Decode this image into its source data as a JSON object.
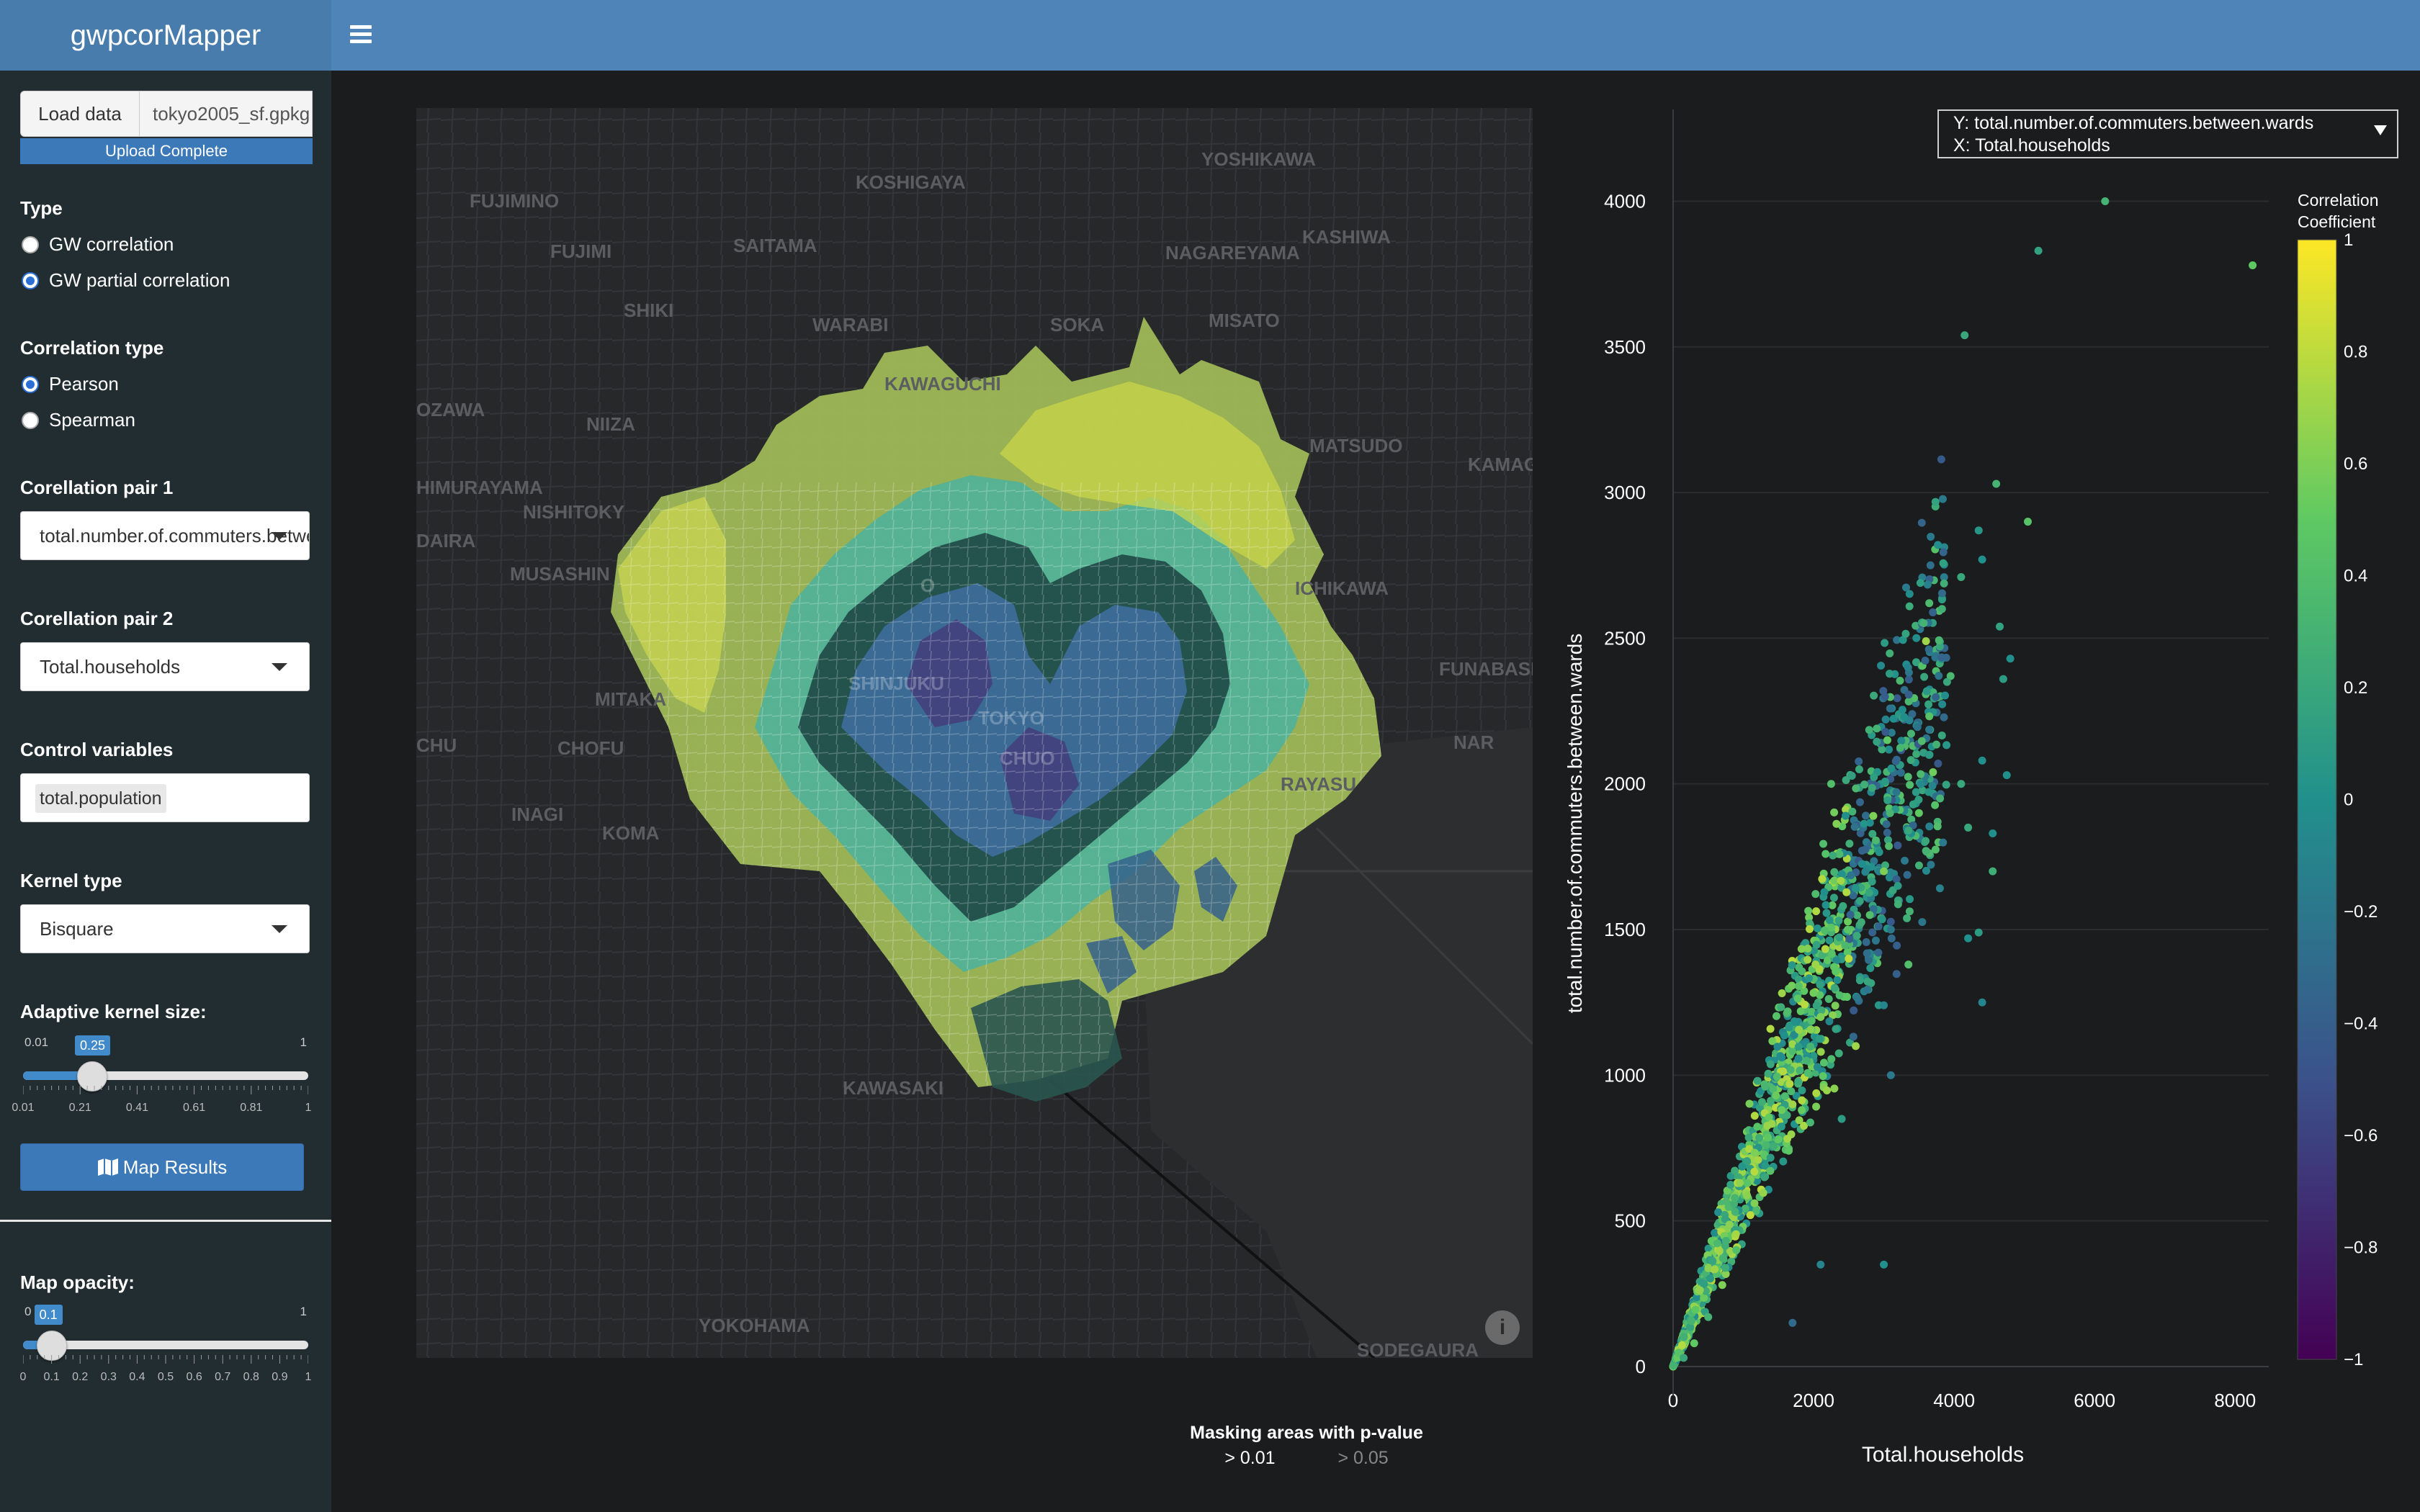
{
  "app": {
    "title": "gwpcorMapper"
  },
  "upload": {
    "button_label": "Load data",
    "file_name": "tokyo2005_sf.gpkg",
    "status": "Upload Complete"
  },
  "type": {
    "label": "Type",
    "options": [
      "GW correlation",
      "GW partial correlation"
    ],
    "selected": "GW partial correlation"
  },
  "correlation_type": {
    "label": "Correlation type",
    "options": [
      "Pearson",
      "Spearman"
    ],
    "selected": "Pearson"
  },
  "pair1": {
    "label": "Corellation pair 1",
    "value": "total.number.of.commuters.between.wards"
  },
  "pair2": {
    "label": "Corellation pair 2",
    "value": "Total.households"
  },
  "control": {
    "label": "Control variables",
    "value": "total.population"
  },
  "kernel": {
    "label": "Kernel type",
    "value": "Bisquare"
  },
  "kernel_size": {
    "label": "Adaptive kernel size:",
    "min": "0.01",
    "max": "1",
    "value": "0.25",
    "value_num": 0.25,
    "tick_labels": [
      "0.01",
      "0.21",
      "0.41",
      "0.61",
      "0.81",
      "1"
    ]
  },
  "map_button": {
    "label": "Map Results",
    "icon": "map-icon"
  },
  "opacity": {
    "label": "Map opacity:",
    "min": "0",
    "max": "1",
    "value": "0.1",
    "value_num": 0.1,
    "tick_labels": [
      "0",
      "0.1",
      "0.2",
      "0.3",
      "0.4",
      "0.5",
      "0.6",
      "0.7",
      "0.8",
      "0.9",
      "1"
    ]
  },
  "map": {
    "place_labels": [
      "KOSHIGAYA",
      "YOSHIKAWA",
      "FUJIMINO",
      "SAITAMA",
      "KASHIWA",
      "FUJIMI",
      "NAGAREYAMA",
      "SHIKI",
      "WARABI",
      "SOKA",
      "MISATO",
      "KAWAGUCHI",
      "OZAWA",
      "NIIZA",
      "MATSUDO",
      "KAMAGA",
      "HIMURAYAMA",
      "NISHITOKY",
      "DAIRA",
      "ICHIKAWA",
      "MUSASHIN",
      "FUNABASH",
      "MITAKA",
      "NAR",
      "CHU",
      "CHOFU",
      "RAYASU",
      "INAGI",
      "KOMA",
      "KAWASAKI",
      "YOKOHAMA",
      "SODEGAURA",
      "TOKYO",
      "CHUO",
      "SHINJUKU",
      "O"
    ],
    "info_icon": "info-icon"
  },
  "mask_legend": {
    "title": "Masking areas with p-value",
    "options": [
      "> 0.01",
      "> 0.05"
    ],
    "selected": "> 0.01"
  },
  "plot_dropdown": {
    "y_text": "Y: total.number.of.commuters.between.wards",
    "x_text": "X: Total.households"
  },
  "colorscale": {
    "title_line1": "Correlation",
    "title_line2": "Coefficient",
    "colors": [
      "#440154",
      "#3b528b",
      "#21908c",
      "#5ec962",
      "#fde725"
    ]
  },
  "chart_data": {
    "type": "scatter",
    "xlabel": "Total.households",
    "ylabel": "total.number.of.commuters.between.wards",
    "xlim": [
      0,
      8500
    ],
    "ylim": [
      0,
      4100
    ],
    "x_ticks": [
      0,
      2000,
      4000,
      6000,
      8000
    ],
    "y_ticks": [
      0,
      500,
      1000,
      1500,
      2000,
      2500,
      3000,
      3500,
      4000
    ],
    "color_ticks": [
      "1",
      "0.8",
      "0.6",
      "0.4",
      "0.2",
      "0",
      "−0.2",
      "−0.4",
      "−0.6",
      "−0.8",
      "−1"
    ],
    "color_range": [
      -1,
      1
    ],
    "points": [
      [
        6150,
        4000,
        0.3
      ],
      [
        5200,
        3830,
        0.15
      ],
      [
        8250,
        3780,
        0.5
      ],
      [
        4150,
        3540,
        0.2
      ],
      [
        4600,
        3030,
        0.3
      ],
      [
        5050,
        2900,
        0.45
      ],
      [
        4400,
        2770,
        0.0
      ],
      [
        4350,
        2870,
        0.05
      ],
      [
        4100,
        2710,
        0.2
      ],
      [
        3600,
        2490,
        0.7
      ],
      [
        4650,
        2540,
        0.15
      ],
      [
        4800,
        2430,
        0.0
      ],
      [
        3950,
        2370,
        0.35
      ],
      [
        3900,
        2350,
        0.2
      ],
      [
        4700,
        2360,
        0.1
      ],
      [
        2900,
        2190,
        0.3
      ],
      [
        3050,
        2150,
        0.5
      ],
      [
        3650,
        2100,
        0.1
      ],
      [
        3700,
        2040,
        0.55
      ],
      [
        4400,
        2080,
        0.0
      ],
      [
        2650,
        2050,
        0.2
      ],
      [
        2250,
        2000,
        0.4
      ],
      [
        4750,
        2030,
        0.0
      ],
      [
        4100,
        2000,
        0.2
      ],
      [
        3800,
        1950,
        0.3
      ],
      [
        2850,
        1890,
        0.6
      ],
      [
        3350,
        1840,
        0.2
      ],
      [
        4550,
        1830,
        0.0
      ],
      [
        3600,
        1770,
        0.3
      ],
      [
        4550,
        1700,
        0.25
      ],
      [
        3200,
        1650,
        0.1
      ],
      [
        4400,
        1250,
        -0.1
      ],
      [
        4200,
        1470,
        0.0
      ],
      [
        4350,
        1490,
        0.1
      ],
      [
        3100,
        1500,
        -0.2
      ],
      [
        3350,
        1380,
        0.4
      ],
      [
        3000,
        1240,
        -0.1
      ],
      [
        2600,
        1100,
        0.7
      ],
      [
        3100,
        1000,
        -0.2
      ],
      [
        2400,
        850,
        0.1
      ],
      [
        3000,
        350,
        0.0
      ],
      [
        2100,
        350,
        -0.1
      ],
      [
        1700,
        150,
        -0.3
      ],
      [
        4200,
        1850,
        0.2
      ],
      [
        3500,
        1900,
        0.5
      ],
      [
        3000,
        1700,
        0.6
      ],
      [
        2800,
        1550,
        0.4
      ],
      [
        2500,
        1400,
        0.8
      ],
      [
        2300,
        1300,
        0.2
      ],
      [
        2100,
        1200,
        0.6
      ],
      [
        1900,
        1050,
        0.3
      ],
      [
        1700,
        900,
        0.7
      ],
      [
        1500,
        780,
        0.5
      ],
      [
        1300,
        650,
        0.2
      ],
      [
        1100,
        520,
        0.8
      ],
      [
        900,
        400,
        0.4
      ],
      [
        700,
        280,
        0.6
      ],
      [
        500,
        170,
        0.3
      ],
      [
        300,
        80,
        0.5
      ],
      [
        150,
        30,
        0.2
      ]
    ]
  }
}
